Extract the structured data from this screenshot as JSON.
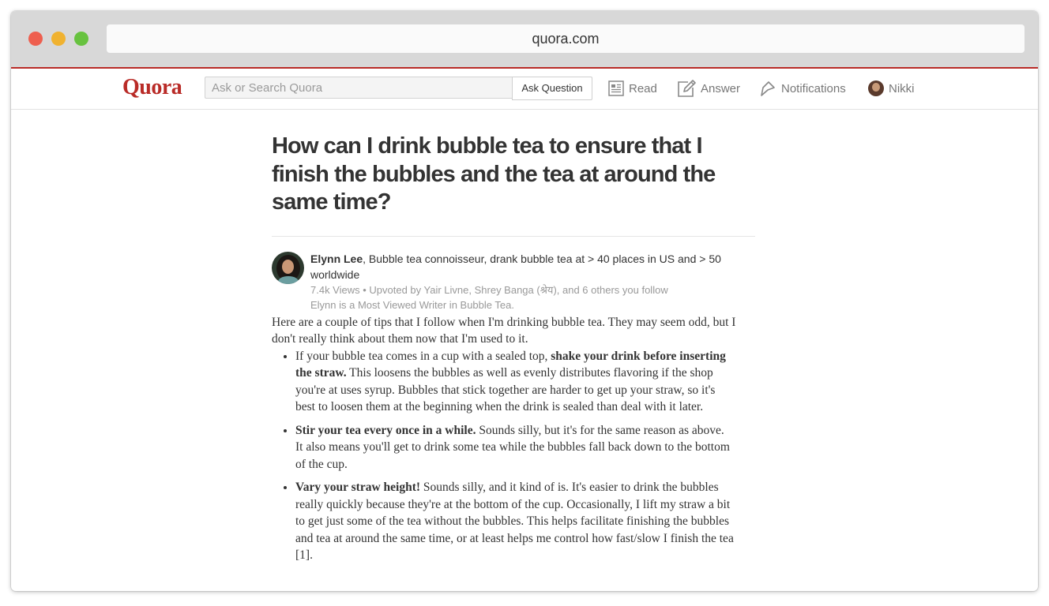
{
  "browser": {
    "url": "quora.com",
    "traffic_lights": [
      "close",
      "minimize",
      "maximize"
    ]
  },
  "navbar": {
    "logo": "Quora",
    "search_placeholder": "Ask or Search Quora",
    "ask_button": "Ask Question",
    "items": [
      {
        "label": "Read",
        "icon": "read-icon"
      },
      {
        "label": "Answer",
        "icon": "answer-pencil-icon"
      },
      {
        "label": "Notifications",
        "icon": "notifications-icon"
      },
      {
        "label": "Nikki",
        "icon": "user-avatar"
      }
    ]
  },
  "question": {
    "title": "How can I drink bubble tea to ensure that I finish the bubbles and the tea at around the same time?"
  },
  "answer": {
    "author_name": "Elynn Lee",
    "author_credential": ", Bubble tea connoisseur, drank bubble tea at > 40 places in US and > 50 worldwide",
    "stats": "7.4k Views • Upvoted by Yair Livne, Shrey Banga (श्रेय), and 6 others you follow",
    "badge": "Elynn is a Most Viewed Writer in Bubble Tea.",
    "intro": "Here are a couple of tips that I follow when I'm drinking bubble tea. They may seem odd, but I don't really think about them now that I'm used to it.",
    "tips": [
      {
        "lead": "If your bubble tea comes in a cup with a sealed top, ",
        "bold": "shake your drink before inserting the straw.",
        "rest": " This loosens the bubbles as well as evenly distributes flavoring if the shop you're at uses syrup. Bubbles that stick together are harder to get up your straw, so it's best to loosen them at the beginning when the drink is sealed than deal with it later."
      },
      {
        "lead": "",
        "bold": "Stir your tea every once in a while.",
        "rest": " Sounds silly, but it's for the same reason as above. It also means you'll get to drink some tea while the bubbles fall back down to the bottom of the cup."
      },
      {
        "lead": "",
        "bold": "Vary your straw height!",
        "rest": " Sounds silly, and it kind of is. It's easier to drink the bubbles really quickly because they're at the bottom of the cup. Occasionally, I lift my straw a bit to get just some of the tea without the bubbles. This helps facilitate finishing the bubbles and tea at around the same time, or at least helps me control how fast/slow I finish the tea [1]."
      }
    ]
  },
  "colors": {
    "brand_red": "#b92b27",
    "chrome_gray": "#d8d8d8",
    "nav_text": "#777777",
    "meta_text": "#999999"
  }
}
